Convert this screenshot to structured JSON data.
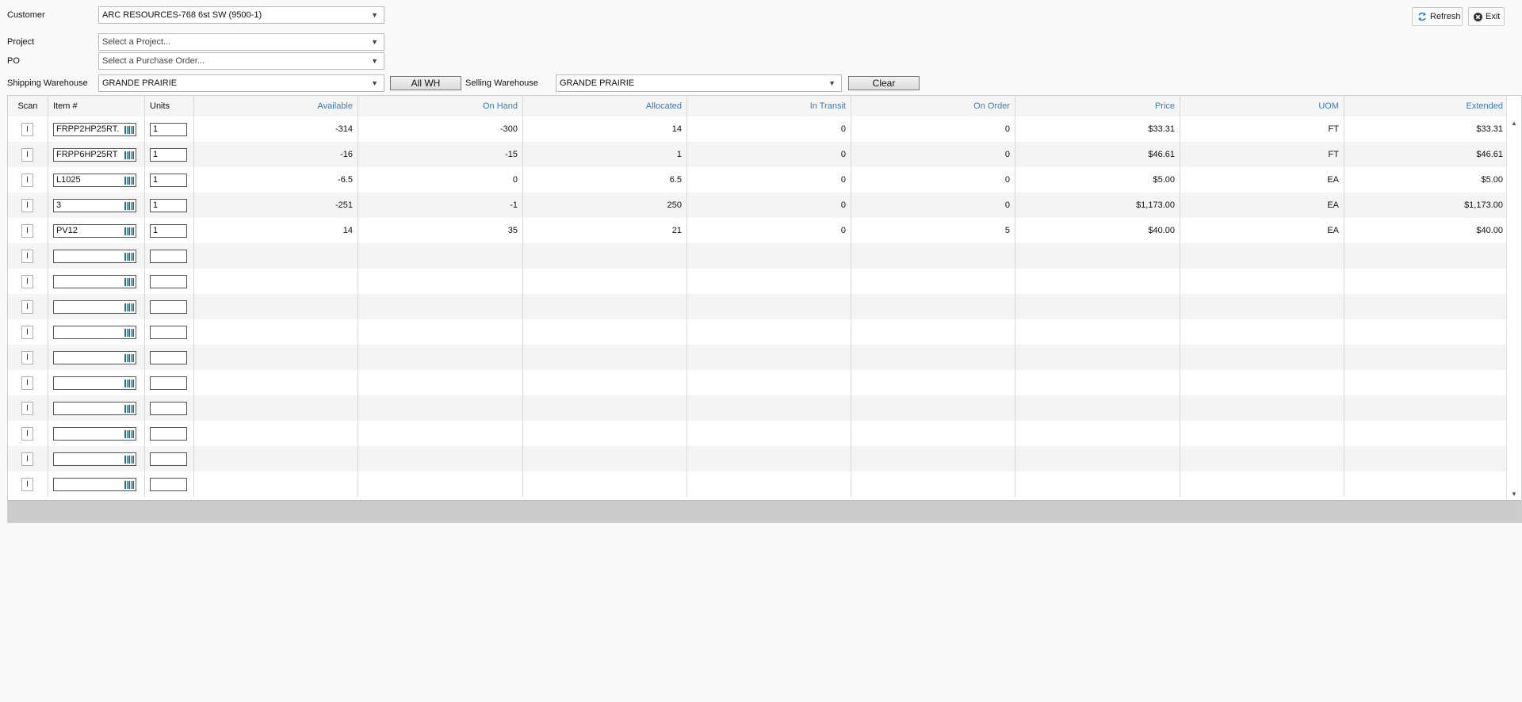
{
  "form": {
    "customer_label": "Customer",
    "customer_value": "ARC RESOURCES-768 6st SW (9500-1)",
    "project_label": "Project",
    "project_placeholder": "Select a Project...",
    "po_label": "PO",
    "po_placeholder": "Select a Purchase Order...",
    "shipping_label": "Shipping Warehouse",
    "shipping_value": "GRANDE PRAIRIE",
    "all_wh_label": "All WH",
    "selling_label": "Selling Warehouse",
    "selling_value": "GRANDE PRAIRIE",
    "clear_label": "Clear"
  },
  "toolbar": {
    "refresh_label": "Refresh",
    "exit_label": "Exit"
  },
  "grid": {
    "headers": {
      "scan": "Scan",
      "item": "Item #",
      "units": "Units",
      "available": "Available",
      "on_hand": "On Hand",
      "allocated": "Allocated",
      "in_transit": "In Transit",
      "on_order": "On Order",
      "price": "Price",
      "uom": "UOM",
      "extended": "Extended"
    },
    "scan_glyph": "I",
    "rows": [
      {
        "item": "FRPP2HP25RT.",
        "units": "1",
        "available": "-314",
        "on_hand": "-300",
        "allocated": "14",
        "in_transit": "0",
        "on_order": "0",
        "price": "$33.31",
        "uom": "FT",
        "extended": "$33.31"
      },
      {
        "item": "FRPP6HP25RT",
        "units": "1",
        "available": "-16",
        "on_hand": "-15",
        "allocated": "1",
        "in_transit": "0",
        "on_order": "0",
        "price": "$46.61",
        "uom": "FT",
        "extended": "$46.61"
      },
      {
        "item": "L1025",
        "units": "1",
        "available": "-6.5",
        "on_hand": "0",
        "allocated": "6.5",
        "in_transit": "0",
        "on_order": "0",
        "price": "$5.00",
        "uom": "EA",
        "extended": "$5.00"
      },
      {
        "item": "3",
        "units": "1",
        "available": "-251",
        "on_hand": "-1",
        "allocated": "250",
        "in_transit": "0",
        "on_order": "0",
        "price": "$1,173.00",
        "uom": "EA",
        "extended": "$1,173.00"
      },
      {
        "item": "PV12",
        "units": "1",
        "available": "14",
        "on_hand": "35",
        "allocated": "21",
        "in_transit": "0",
        "on_order": "5",
        "price": "$40.00",
        "uom": "EA",
        "extended": "$40.00"
      },
      {
        "item": "",
        "units": "",
        "available": "",
        "on_hand": "",
        "allocated": "",
        "in_transit": "",
        "on_order": "",
        "price": "",
        "uom": "",
        "extended": ""
      },
      {
        "item": "",
        "units": "",
        "available": "",
        "on_hand": "",
        "allocated": "",
        "in_transit": "",
        "on_order": "",
        "price": "",
        "uom": "",
        "extended": ""
      },
      {
        "item": "",
        "units": "",
        "available": "",
        "on_hand": "",
        "allocated": "",
        "in_transit": "",
        "on_order": "",
        "price": "",
        "uom": "",
        "extended": ""
      },
      {
        "item": "",
        "units": "",
        "available": "",
        "on_hand": "",
        "allocated": "",
        "in_transit": "",
        "on_order": "",
        "price": "",
        "uom": "",
        "extended": ""
      },
      {
        "item": "",
        "units": "",
        "available": "",
        "on_hand": "",
        "allocated": "",
        "in_transit": "",
        "on_order": "",
        "price": "",
        "uom": "",
        "extended": ""
      },
      {
        "item": "",
        "units": "",
        "available": "",
        "on_hand": "",
        "allocated": "",
        "in_transit": "",
        "on_order": "",
        "price": "",
        "uom": "",
        "extended": ""
      },
      {
        "item": "",
        "units": "",
        "available": "",
        "on_hand": "",
        "allocated": "",
        "in_transit": "",
        "on_order": "",
        "price": "",
        "uom": "",
        "extended": ""
      },
      {
        "item": "",
        "units": "",
        "available": "",
        "on_hand": "",
        "allocated": "",
        "in_transit": "",
        "on_order": "",
        "price": "",
        "uom": "",
        "extended": ""
      },
      {
        "item": "",
        "units": "",
        "available": "",
        "on_hand": "",
        "allocated": "",
        "in_transit": "",
        "on_order": "",
        "price": "",
        "uom": "",
        "extended": ""
      },
      {
        "item": "",
        "units": "",
        "available": "",
        "on_hand": "",
        "allocated": "",
        "in_transit": "",
        "on_order": "",
        "price": "",
        "uom": "",
        "extended": ""
      }
    ]
  },
  "colors": {
    "header_numeric_text": "#3a7bbf",
    "row_alt": "#f4f4f4",
    "footer_bar": "#cccccc",
    "barcode_icon": "#2d6d80"
  },
  "icons": {
    "refresh": "refresh-icon",
    "exit": "close-circle-icon",
    "barcode": "barcode-icon",
    "dropdown": "triangle-down-icon"
  }
}
